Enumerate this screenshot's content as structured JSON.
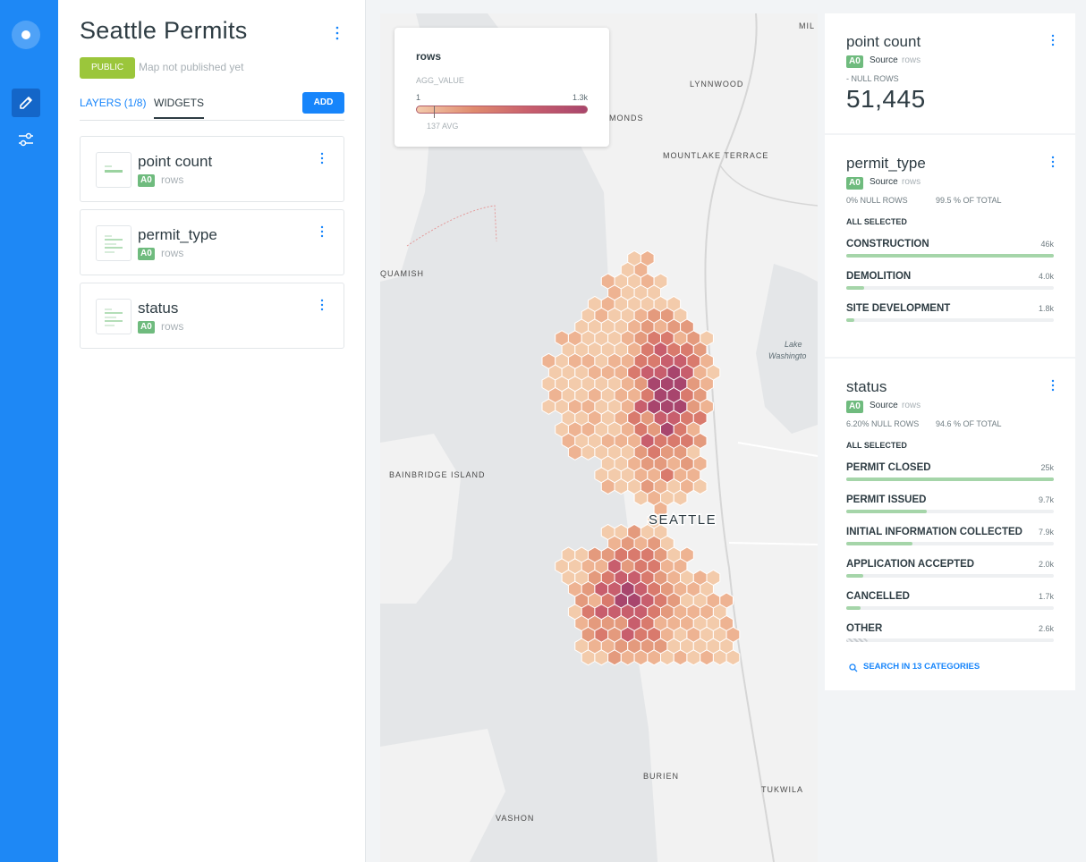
{
  "rail": {
    "items": [
      "home",
      "edit",
      "settings"
    ]
  },
  "editor": {
    "title": "Seattle Permits",
    "public_badge": "PUBLIC",
    "publish_status": "Map not published yet",
    "tabs": {
      "layers": "LAYERS (1/8)",
      "widgets": "WIDGETS"
    },
    "add_label": "ADD",
    "widgets": [
      {
        "name": "point count",
        "tag": "A0",
        "source": "rows"
      },
      {
        "name": "permit_type",
        "tag": "A0",
        "source": "rows"
      },
      {
        "name": "status",
        "tag": "A0",
        "source": "rows"
      }
    ]
  },
  "map": {
    "labels": {
      "mil": "MIL",
      "lynnwood": "LYNNWOOD",
      "edmonds": "MONDS",
      "mountlake": "MOUNTLAKE TERRACE",
      "suquamish": "QUAMISH",
      "lake_wa_1": "Lake",
      "lake_wa_2": "Washingto",
      "bainbridge": "BAINBRIDGE ISLAND",
      "seattle": "SEATTLE",
      "burien": "BURIEN",
      "tukwila": "TUKWILA",
      "vashon": "VASHON"
    },
    "legend": {
      "title": "rows",
      "subtitle": "AGG_VALUE",
      "min": "1",
      "max": "1.3k",
      "avg": "137 AVG"
    },
    "colors": [
      "#f3cbab",
      "#eeb392",
      "#e49a7d",
      "#d97a6d",
      "#c85e6d",
      "#a8456d"
    ]
  },
  "widgets_panel": {
    "point_count": {
      "title": "point count",
      "tag": "A0",
      "source_label": "Source",
      "source_name": "rows",
      "null_rows": "- NULL ROWS",
      "value": "51,445"
    },
    "permit_type": {
      "title": "permit_type",
      "tag": "A0",
      "source_label": "Source",
      "source_name": "rows",
      "null_rows": "0% NULL ROWS",
      "of_total": "99.5 % OF TOTAL",
      "all_selected": "ALL SELECTED",
      "categories": [
        {
          "name": "CONSTRUCTION",
          "value": "46k",
          "fraction": 1.0
        },
        {
          "name": "DEMOLITION",
          "value": "4.0k",
          "fraction": 0.087
        },
        {
          "name": "SITE DEVELOPMENT",
          "value": "1.8k",
          "fraction": 0.04
        }
      ]
    },
    "status": {
      "title": "status",
      "tag": "A0",
      "source_label": "Source",
      "source_name": "rows",
      "null_rows": "6.20% NULL ROWS",
      "of_total": "94.6 % OF TOTAL",
      "all_selected": "ALL SELECTED",
      "categories": [
        {
          "name": "PERMIT CLOSED",
          "value": "25k",
          "fraction": 1.0
        },
        {
          "name": "PERMIT ISSUED",
          "value": "9.7k",
          "fraction": 0.39
        },
        {
          "name": "INITIAL INFORMATION COLLECTED",
          "value": "7.9k",
          "fraction": 0.32
        },
        {
          "name": "APPLICATION ACCEPTED",
          "value": "2.0k",
          "fraction": 0.08
        },
        {
          "name": "CANCELLED",
          "value": "1.7k",
          "fraction": 0.068
        },
        {
          "name": "OTHER",
          "value": "2.6k",
          "fraction": 0.104
        }
      ],
      "search_label": "SEARCH IN 13 CATEGORIES"
    }
  }
}
